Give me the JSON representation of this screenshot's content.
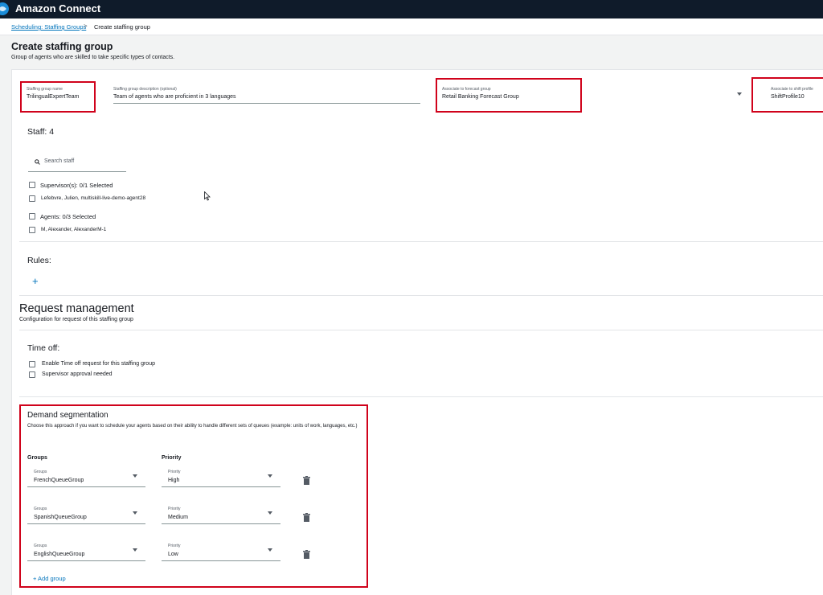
{
  "app": {
    "title": "Amazon Connect"
  },
  "breadcrumb": {
    "parent": "Scheduling: Staffing Groups",
    "separator": ">",
    "current": "Create staffing group"
  },
  "page": {
    "title": "Create staffing group",
    "subtitle": "Group of agents who are skilled to take specific types of contacts."
  },
  "form": {
    "name": {
      "label": "Staffing group name",
      "value": "TrilingualExpertTeam"
    },
    "description": {
      "label": "Staffing group description (optional)",
      "value": "Team of agents who are proficient in 3 languages"
    },
    "forecast": {
      "label": "Associate to forecast group",
      "value": "Retail Banking Forecast Group"
    },
    "shift": {
      "label": "Associate to shift profile",
      "value": "ShiftProfile10"
    }
  },
  "staff": {
    "title": "Staff: 4",
    "search_placeholder": "Search staff",
    "supervisors_label": "Supervisor(s): 0/1 Selected",
    "supervisors": [
      "Lefebvre, Julien, multiskill-live-demo-agent28"
    ],
    "agents_label": "Agents: 0/3 Selected",
    "agents": [
      "M, Alexander, AlexanderM-1"
    ]
  },
  "rules": {
    "title": "Rules:",
    "add_symbol": "+"
  },
  "request_management": {
    "title": "Request management",
    "subtitle": "Configuration for request of this staffing group",
    "time_off_title": "Time off:",
    "options": [
      "Enable Time off request for this staffing group",
      "Supervisor approval needed"
    ]
  },
  "demand": {
    "title": "Demand segmentation",
    "subtitle": "Choose this approach if you want to schedule your agents based on their ability to handle different sets of queues (example: units of work, languages, etc.)",
    "groups_header": "Groups",
    "priority_header": "Priority",
    "group_field_label": "Groups",
    "priority_field_label": "Priority",
    "rows": [
      {
        "group": "FrenchQueueGroup",
        "priority": "High"
      },
      {
        "group": "SpanishQueueGroup",
        "priority": "Medium"
      },
      {
        "group": "EnglishQueueGroup",
        "priority": "Low"
      }
    ],
    "add_group_label": "+ Add group"
  },
  "colors": {
    "accent": "#0073bb",
    "highlight": "#d0021b",
    "topbar": "#0f1b2a"
  }
}
